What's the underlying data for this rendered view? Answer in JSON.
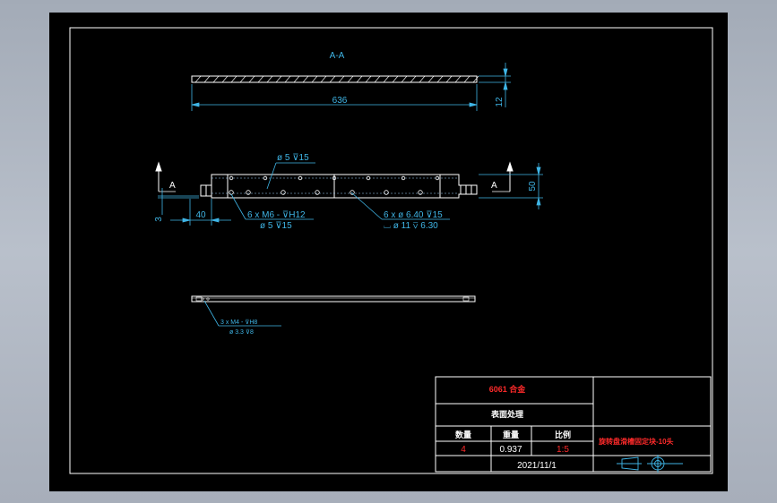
{
  "drawing": {
    "section_label": "A-A",
    "section_marker_left": "A",
    "section_marker_right": "A",
    "dim_length": "636",
    "dim_thickness": "12",
    "dim_height": "50",
    "dim_offset_x": "40",
    "dim_offset_y": "3",
    "callout_hole_top": "ø 5 ⊽15",
    "callout_thread_line1": "6 x  M6 - ⊽H12",
    "callout_thread_line2": "ø  5 ⊽15",
    "callout_cb_line1": "6 x ø 6.40 ⊽15",
    "callout_cb_line2": "⌴ ø 11 ⊽ 6.30",
    "callout_bottom_line1": "3 x  M4 - ⊽H8",
    "callout_bottom_line2": "ø  3.3 ⊽8"
  },
  "title_block": {
    "material": "6061 合金",
    "surface": "表面处理",
    "qty_label": "数量",
    "weight_label": "重量",
    "scale_label": "比例",
    "qty_value": "4",
    "weight_value": "0.937",
    "scale_value": "1:5",
    "date": "2021/11/1",
    "drawing_name": "旋转盘滑槽固定块-10头"
  },
  "colors": {
    "line": "#ffffff",
    "dim": "#3fb5e6",
    "hole": "#9fd3ff",
    "red": "#ff2a2a",
    "paper": "#000000",
    "background": "#aeb5c0"
  }
}
